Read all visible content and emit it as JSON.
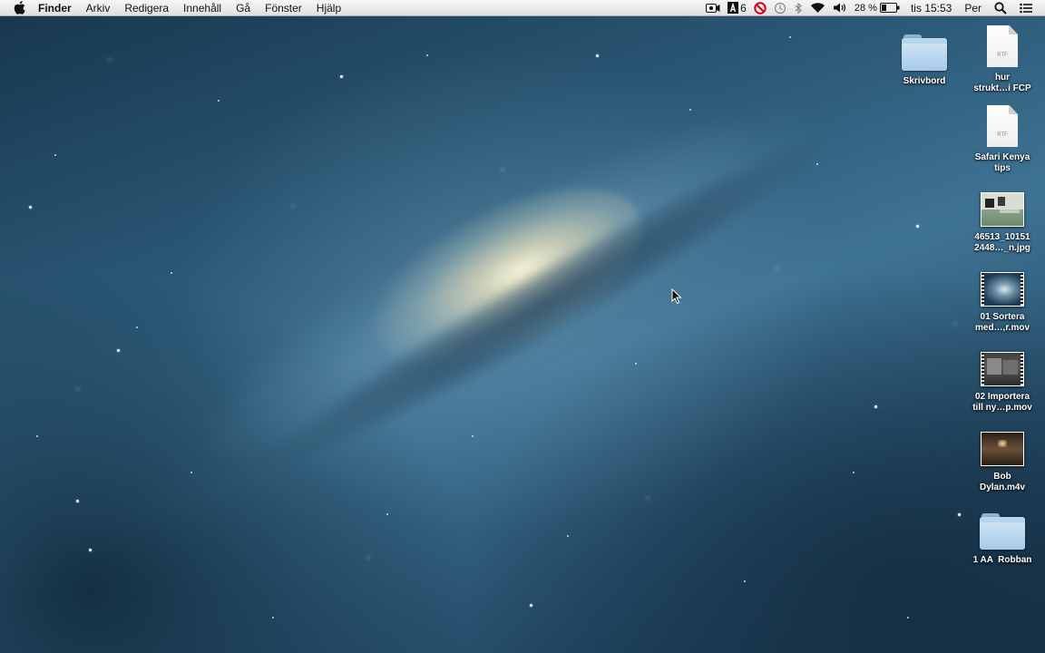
{
  "menubar": {
    "app_name": "Finder",
    "menus": [
      "Arkiv",
      "Redigera",
      "Innehåll",
      "Gå",
      "Fönster",
      "Hjälp"
    ],
    "status": {
      "adobe_badge": "6",
      "battery": "28 %",
      "clock": "tis 15:53",
      "user": "Per"
    }
  },
  "desktop": {
    "icons": [
      {
        "label_1": "Skrivbord",
        "label_2": "",
        "kind": "folder-icon"
      },
      {
        "label_1": "hur",
        "label_2": "strukt…i FCP",
        "kind": "rtf-document-icon",
        "tag": "RTF"
      },
      {
        "label_1": "Safari Kenya",
        "label_2": "tips",
        "kind": "rtf-document-icon",
        "tag": "RTF"
      },
      {
        "label_1": "46513_10151",
        "label_2": "2448…_n.jpg",
        "kind": "jpg-thumbnail-icon"
      },
      {
        "label_1": "01 Sortera",
        "label_2": "med…,r.mov",
        "kind": "movie-thumbnail-icon"
      },
      {
        "label_1": "02 Importera",
        "label_2": "till ny…p.mov",
        "kind": "movie-thumbnail-icon"
      },
      {
        "label_1": "Bob",
        "label_2": "Dylan.m4v",
        "kind": "movie-thumbnail-icon"
      },
      {
        "label_1": "1 AA  Robban",
        "label_2": "",
        "kind": "folder-icon"
      }
    ]
  },
  "colors": {
    "menubar_bg": "#ececec",
    "folder_blue": "#a5c9e8",
    "forbidden_red": "#d0021b"
  }
}
